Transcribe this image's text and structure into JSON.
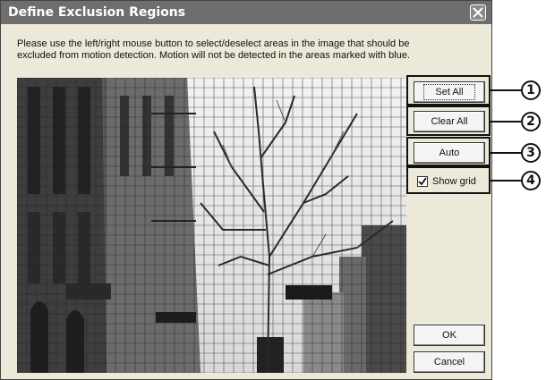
{
  "dialog": {
    "title": "Define Exclusion Regions",
    "instructions": "Please use the left/right mouse button to select/deselect areas in the image that should be excluded from motion detection. Motion will not be detected in the areas marked with blue."
  },
  "buttons": {
    "set_all": "Set All",
    "clear_all": "Clear All",
    "auto": "Auto",
    "ok": "OK",
    "cancel": "Cancel"
  },
  "show_grid": {
    "label": "Show grid",
    "checked": true
  },
  "callouts": [
    "1",
    "2",
    "3",
    "4"
  ]
}
